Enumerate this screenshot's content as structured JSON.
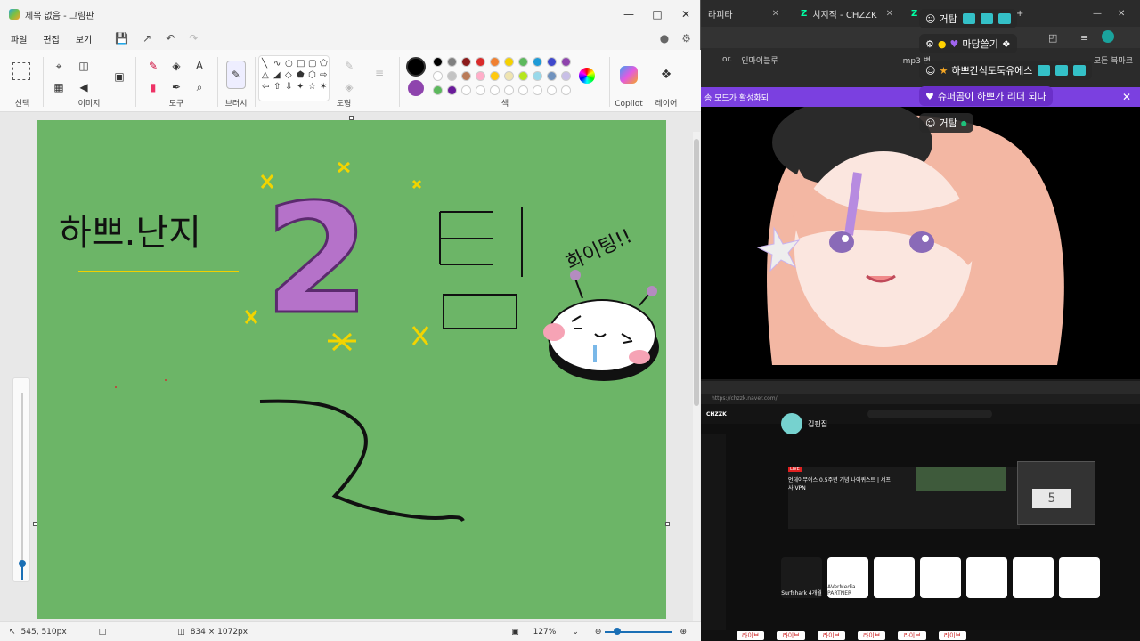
{
  "paint": {
    "title": "제목 없음 - 그림판",
    "menu": [
      "파일",
      "편집",
      "보기"
    ],
    "groups": {
      "select": "선택",
      "image": "이미지",
      "tools": "도구",
      "brush": "브러시",
      "shapes": "도형",
      "colors": "색",
      "copilot": "Copilot",
      "layers": "레이어"
    },
    "palette": [
      "#000000",
      "#7f7f7f",
      "#8b1a1a",
      "#d92b2b",
      "#f08030",
      "#f5d100",
      "#5cb85c",
      "#1e9bd7",
      "#3f48cc",
      "#8e44ad",
      "#ffffff",
      "#c3c3c3",
      "#b97a57",
      "#ffaec9",
      "#ffc90e",
      "#efe4b0",
      "#b5e61d",
      "#99d9ea",
      "#7092be",
      "#c8bfe7",
      "#5cb85c",
      "#6a1b9a",
      "#ffffff",
      "#ffffff",
      "#ffffff",
      "#ffffff",
      "#ffffff",
      "#ffffff",
      "#ffffff",
      "#ffffff"
    ],
    "color1": "#000000",
    "color2": "#8e44ad",
    "status": {
      "cursor": "545, 510px",
      "size": "834 × 1072px",
      "zoom": "127%"
    },
    "canvas": {
      "text_name": "하쁘.난지",
      "big_number": "2",
      "team": "팀",
      "fighting": "화이팅!!"
    }
  },
  "browser": {
    "tabs": [
      {
        "label": "라피타"
      },
      {
        "label": "치지직 - CHZZK"
      },
      {
        "label": ""
      }
    ],
    "bookmarks": [
      "or.",
      "인마이블루",
      "mp3 변",
      "모든 북마크"
    ],
    "notice": "송 모드가 활성화되",
    "chat": [
      {
        "text": "거탐",
        "purple": false
      },
      {
        "text": "마당쓸기",
        "purple": false
      },
      {
        "text": "하쁘간식도둑유에스",
        "purple": false
      },
      {
        "text": "슈퍼곰이 하쁘가 리더 되다",
        "purple": true
      },
      {
        "text": "거탐",
        "purple": false
      }
    ]
  },
  "lower": {
    "url": "https://chzzk.naver.com/",
    "channel": "김핀집",
    "live_badge": "LIVE",
    "live_title": "언데이무이스 0.5주년 기념 나이퀴스트 | 서프사:VPN",
    "preview_number": "5",
    "tiles": [
      {
        "label": "Surfshark 4개월",
        "color": "#1a1a1a"
      },
      {
        "label": "AVerMedia PARTNER",
        "color": "#ffffff"
      },
      {
        "label": "",
        "color": "#ffffff"
      },
      {
        "label": "",
        "color": "#ffffff"
      },
      {
        "label": "",
        "color": "#ffffff"
      },
      {
        "label": "",
        "color": "#ffffff"
      },
      {
        "label": "",
        "color": "#ffffff"
      }
    ],
    "bottom_tags": [
      "라이브",
      "라이브",
      "라이브",
      "라이브",
      "라이브",
      "라이브"
    ]
  }
}
